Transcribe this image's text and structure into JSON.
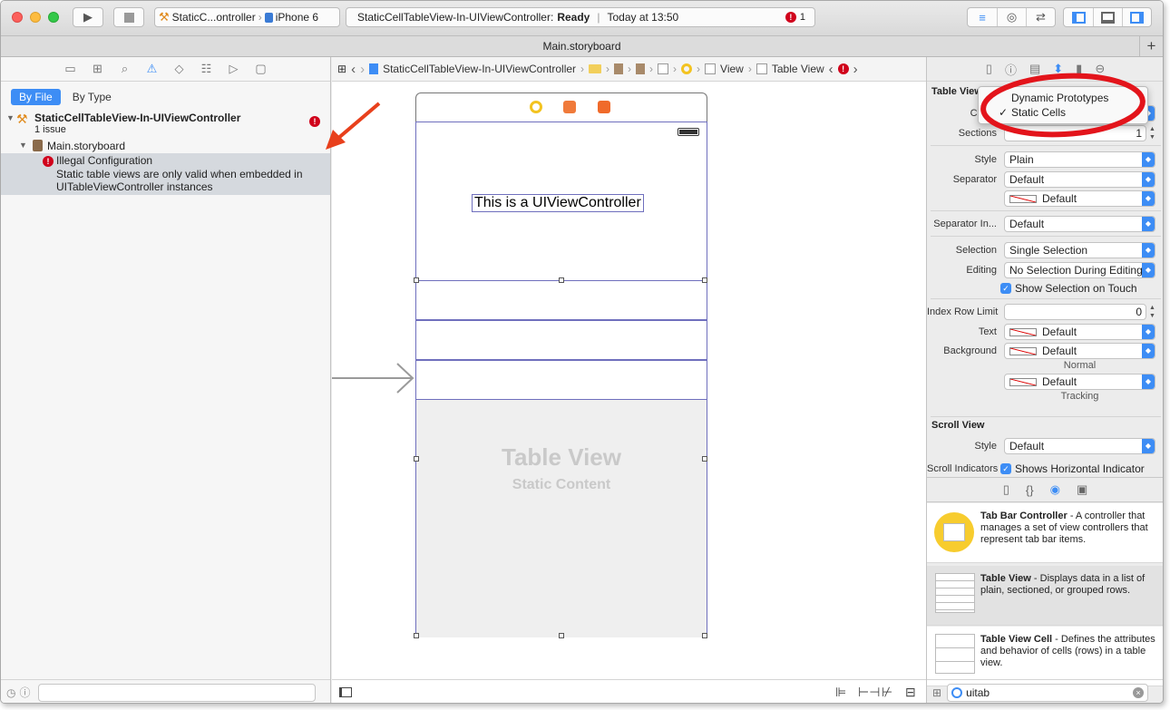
{
  "toolbar": {
    "scheme": "StaticC...ontroller",
    "device": "iPhone 6",
    "status_project": "StaticCellTableView-In-UIViewController:",
    "status_state": "Ready",
    "status_time": "Today at 13:50",
    "issue_count": "1"
  },
  "tab": {
    "title": "Main.storyboard"
  },
  "navigator": {
    "filter_by_file": "By File",
    "filter_by_type": "By Type",
    "project_name": "StaticCellTableView-In-UIViewController",
    "project_issues": "1 issue",
    "file_name": "Main.storyboard",
    "issue_title": "Illegal Configuration",
    "issue_detail_1": "Static table views are only valid when embedded in",
    "issue_detail_2": "UITableViewController instances"
  },
  "jumpbar": {
    "project": "StaticCellTableView-In-UIViewController",
    "view": "View",
    "table_view": "Table View"
  },
  "canvas": {
    "label_text": "This is a UIViewController",
    "table_title": "Table View",
    "table_subtitle": "Static Content"
  },
  "inspector": {
    "section_table_view": "Table View",
    "content_label": "Conte",
    "dropdown_option_1": "Dynamic Prototypes",
    "dropdown_option_2": "Static Cells",
    "sections_label": "Sections",
    "sections_value": "1",
    "style_label": "Style",
    "style_value": "Plain",
    "separator_label": "Separator",
    "separator_value": "Default",
    "separator_color": "Default",
    "separator_inset_label": "Separator In...",
    "separator_inset_value": "Default",
    "selection_label": "Selection",
    "selection_value": "Single Selection",
    "editing_label": "Editing",
    "editing_value": "No Selection During Editing",
    "show_selection_label": "Show Selection on Touch",
    "index_row_limit_label": "Index Row Limit",
    "index_row_limit_value": "0",
    "text_label": "Text",
    "text_value": "Default",
    "background_label": "Background",
    "background_value": "Default",
    "normal_caption": "Normal",
    "tracking_value": "Default",
    "tracking_caption": "Tracking",
    "section_scroll_view": "Scroll View",
    "scroll_style_label": "Style",
    "scroll_style_value": "Default",
    "scroll_indicators_label": "Scroll Indicators",
    "scroll_indicators_value": "Shows Horizontal Indicator"
  },
  "library": {
    "items": [
      {
        "title": "Tab Bar Controller",
        "desc": " - A controller that manages a set of view controllers that represent tab bar items."
      },
      {
        "title": "Table View",
        "desc": " - Displays data in a list of plain, sectioned, or grouped rows."
      },
      {
        "title": "Table View Cell",
        "desc": " - Defines the attributes and behavior of cells (rows) in a table view."
      }
    ],
    "search_value": "uitab"
  },
  "colors": {
    "accent": "#3d8df5",
    "error": "#d0021b",
    "annotation_red": "#e3141b",
    "arrow_red": "#e8401c"
  }
}
